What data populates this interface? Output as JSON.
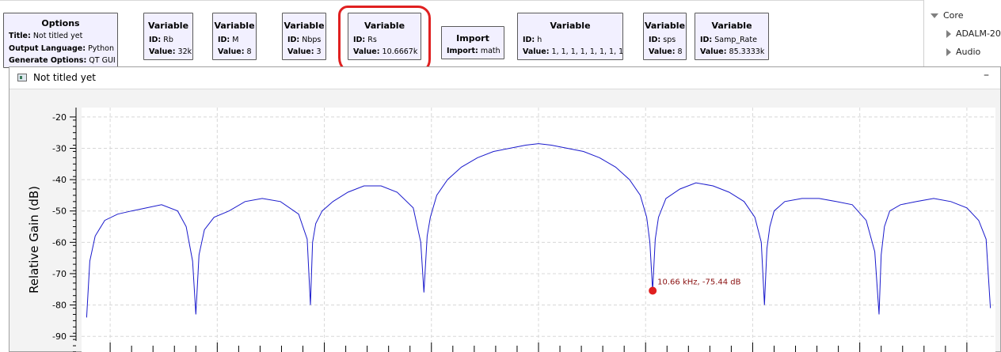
{
  "blocks": [
    {
      "id": "options",
      "title": "Options",
      "rows": [
        [
          "Title:",
          "Not titled yet"
        ],
        [
          "Output Language:",
          "Python"
        ],
        [
          "Generate Options:",
          "QT GUI"
        ]
      ]
    },
    {
      "id": "var-rb",
      "title": "Variable",
      "rows": [
        [
          "ID:",
          "Rb"
        ],
        [
          "Value:",
          "32k"
        ]
      ]
    },
    {
      "id": "var-m",
      "title": "Variable",
      "rows": [
        [
          "ID:",
          "M"
        ],
        [
          "Value:",
          "8"
        ]
      ]
    },
    {
      "id": "var-nbps",
      "title": "Variable",
      "rows": [
        [
          "ID:",
          "Nbps"
        ],
        [
          "Value:",
          "3"
        ]
      ]
    },
    {
      "id": "var-rs",
      "title": "Variable",
      "rows": [
        [
          "ID:",
          "Rs"
        ],
        [
          "Value:",
          "10.6667k"
        ]
      ]
    },
    {
      "id": "import-math",
      "title": "Import",
      "rows": [
        [
          "Import:",
          "math"
        ]
      ]
    },
    {
      "id": "var-h",
      "title": "Variable",
      "rows": [
        [
          "ID:",
          "h"
        ],
        [
          "Value:",
          "1, 1, 1, 1, 1, 1, 1, 1"
        ]
      ]
    },
    {
      "id": "var-sps",
      "title": "Variable",
      "rows": [
        [
          "ID:",
          "sps"
        ],
        [
          "Value:",
          "8"
        ]
      ]
    },
    {
      "id": "var-samp-rate",
      "title": "Variable",
      "rows": [
        [
          "ID:",
          "Samp_Rate"
        ],
        [
          "Value:",
          "85.3333k"
        ]
      ]
    }
  ],
  "tree": {
    "core": "Core",
    "items": [
      "ADALM-20",
      "Audio"
    ]
  },
  "window": {
    "title": "Not titled yet",
    "minimize": "–"
  },
  "colors": {
    "block_fill": "#f2f0ff",
    "trace": "#1a1acc",
    "marker": "#e02020",
    "highlight": "#e02020"
  },
  "chart_data": {
    "type": "line",
    "title": "",
    "xlabel": "",
    "ylabel": "Relative Gain (dB)",
    "ylim": [
      -95,
      -17
    ],
    "yticks": [
      -20,
      -30,
      -40,
      -50,
      -60,
      -70,
      -80,
      -90
    ],
    "xlim": [
      -42.67,
      42.67
    ],
    "x_unit": "kHz",
    "grid": true,
    "series": [
      {
        "name": "",
        "x": [
          -42.2,
          -41.9,
          -41.4,
          -40.5,
          -39.3,
          -38.0,
          -36.6,
          -35.2,
          -33.7,
          -32.9,
          -32.3,
          -32.0,
          -31.7,
          -31.2,
          -30.3,
          -28.9,
          -27.4,
          -25.8,
          -24.1,
          -22.4,
          -21.6,
          -21.3,
          -21.1,
          -20.8,
          -20.2,
          -19.2,
          -17.8,
          -16.3,
          -14.7,
          -13.2,
          -11.7,
          -11.0,
          -10.7,
          -10.4,
          -10.1,
          -9.5,
          -8.5,
          -7.2,
          -5.7,
          -4.2,
          -2.7,
          -1.2,
          0.0,
          1.2,
          2.7,
          4.2,
          5.7,
          7.2,
          8.5,
          9.5,
          10.1,
          10.4,
          10.66,
          10.9,
          11.2,
          11.9,
          13.2,
          14.7,
          16.3,
          17.8,
          19.2,
          20.2,
          20.8,
          21.1,
          21.33,
          21.6,
          22.0,
          23.0,
          24.6,
          26.2,
          27.8,
          29.3,
          30.6,
          31.4,
          31.8,
          32.0,
          32.3,
          32.8,
          33.8,
          35.3,
          36.9,
          38.5,
          40.0,
          41.1,
          41.8,
          42.2
        ],
        "y": [
          -84,
          -66,
          -58,
          -53,
          -51,
          -50,
          -49,
          -48,
          -50,
          -55,
          -66,
          -83,
          -64,
          -56,
          -52,
          -50,
          -47,
          -46,
          -47,
          -51,
          -59,
          -80,
          -60,
          -54,
          -50,
          -47,
          -44,
          -42,
          -42,
          -44,
          -49,
          -60,
          -76,
          -58,
          -52,
          -45,
          -40,
          -36,
          -33,
          -31,
          -30,
          -29,
          -28.5,
          -29,
          -30,
          -31,
          -33,
          -36,
          -40,
          -45,
          -52,
          -60,
          -75.44,
          -59,
          -52,
          -46,
          -43,
          -41,
          -42,
          -44,
          -47,
          -52,
          -60,
          -80,
          -62,
          -55,
          -50,
          -47,
          -46,
          -46,
          -47,
          -48,
          -53,
          -63,
          -83,
          -64,
          -55,
          -50,
          -48,
          -47,
          -46,
          -47,
          -49,
          -53,
          -59,
          -81
        ]
      }
    ],
    "marker": {
      "label": "10.66 kHz, -75.44 dB",
      "x": 10.66,
      "y": -75.44
    }
  }
}
